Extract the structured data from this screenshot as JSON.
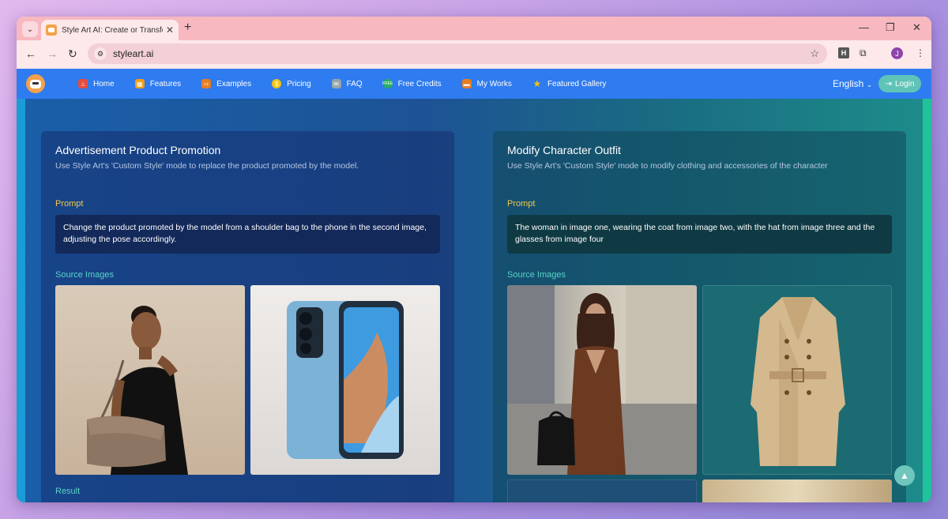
{
  "browser": {
    "tab_title": "Style Art AI: Create or Transform",
    "url": "styleart.ai",
    "profile_initial": "J",
    "extension_letter": "H"
  },
  "site": {
    "nav": [
      {
        "label": "Home",
        "icon": "home-icon",
        "color": "#e74c3c"
      },
      {
        "label": "Features",
        "icon": "grid-icon",
        "color": "#f39c12"
      },
      {
        "label": "Examples",
        "icon": "signpost-icon",
        "color": "#e67e22"
      },
      {
        "label": "Pricing",
        "icon": "dollar-icon",
        "color": "#f1c40f"
      },
      {
        "label": "FAQ",
        "icon": "chat-icon",
        "color": "#95a5a6"
      },
      {
        "label": "Free Credits",
        "icon": "free-badge-icon",
        "color": "#27ae60"
      },
      {
        "label": "My Works",
        "icon": "folder-icon",
        "color": "#e67e22"
      },
      {
        "label": "Featured Gallery",
        "icon": "star-icon",
        "color": "#f1c40f"
      }
    ],
    "language": "English",
    "login_label": "Login"
  },
  "cards": [
    {
      "title": "Advertisement Product Promotion",
      "description": "Use Style Art's 'Custom Style' mode to replace the product promoted by the model.",
      "prompt_label": "Prompt",
      "prompt": "Change the product promoted by the model from a shoulder bag to the phone in the second image, adjusting the pose accordingly.",
      "source_label": "Source Images",
      "result_label": "Result"
    },
    {
      "title": "Modify Character Outfit",
      "description": "Use Style Art's 'Custom Style' mode to modify clothing and accessories of the character",
      "prompt_label": "Prompt",
      "prompt": "The woman in image one, wearing the coat from image two, with the hat from image three and the glasses from image four",
      "source_label": "Source Images"
    }
  ]
}
